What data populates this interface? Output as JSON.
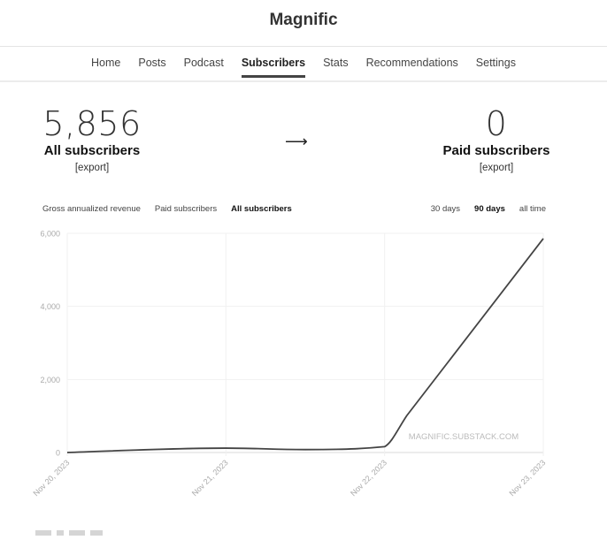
{
  "header": {
    "title": "Magnific"
  },
  "nav": {
    "items": [
      {
        "label": "Home",
        "active": false
      },
      {
        "label": "Posts",
        "active": false
      },
      {
        "label": "Podcast",
        "active": false
      },
      {
        "label": "Subscribers",
        "active": true
      },
      {
        "label": "Stats",
        "active": false
      },
      {
        "label": "Recommendations",
        "active": false
      },
      {
        "label": "Settings",
        "active": false
      }
    ]
  },
  "stats": {
    "all": {
      "value": "5,856",
      "label": "All subscribers",
      "export": "[export]"
    },
    "arrow": "⟶",
    "paid": {
      "value": "0",
      "label": "Paid subscribers",
      "export": "[export]"
    }
  },
  "metric_tabs": [
    {
      "label": "Gross annualized revenue",
      "active": false
    },
    {
      "label": "Paid subscribers",
      "active": false
    },
    {
      "label": "All subscribers",
      "active": true
    }
  ],
  "range_tabs": [
    {
      "label": "30 days",
      "active": false
    },
    {
      "label": "90 days",
      "active": true
    },
    {
      "label": "all time",
      "active": false
    }
  ],
  "chart_data": {
    "type": "line",
    "title": "",
    "xlabel": "",
    "ylabel": "",
    "x": [
      "Nov 20, 2023",
      "Nov 21, 2023",
      "Nov 22, 2023",
      "Nov 23, 2023"
    ],
    "series": [
      {
        "name": "All subscribers",
        "color": "#444444",
        "values": [
          0,
          120,
          160,
          5856
        ]
      }
    ],
    "intermediate_dip": {
      "between": [
        "Nov 21, 2023",
        "Nov 22, 2023"
      ],
      "value": 80
    },
    "ylim": [
      0,
      6000
    ],
    "yticks": [
      0,
      2000,
      4000,
      6000
    ],
    "ytick_labels": [
      "0",
      "2,000",
      "4,000",
      "6,000"
    ],
    "grid": true,
    "watermark": "MAGNIFIC.SUBSTACK.COM"
  }
}
